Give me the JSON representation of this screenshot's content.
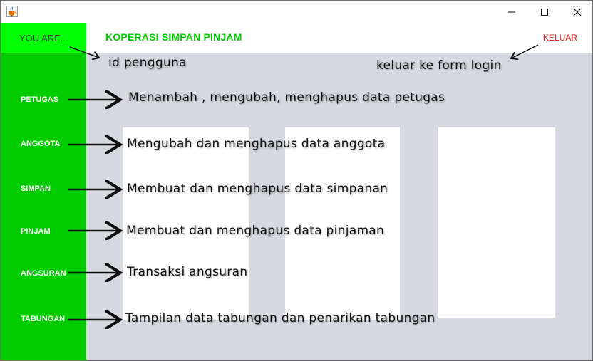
{
  "window": {
    "icon": "java-coffee-cup-icon",
    "controls": {
      "minimize": "minimize-icon",
      "maximize": "maximize-icon",
      "close": "close-icon"
    }
  },
  "header": {
    "user_label": "YOU ARE...",
    "title": "KOPERASI SIMPAN PINJAM",
    "logout_label": "KELUAR"
  },
  "sidebar": {
    "items": [
      {
        "label": "PETUGAS"
      },
      {
        "label": "ANGGOTA"
      },
      {
        "label": "SIMPAN"
      },
      {
        "label": "PINJAM"
      },
      {
        "label": "ANGSURAN"
      },
      {
        "label": "TABUNGAN"
      }
    ]
  },
  "annotations": {
    "user_id": "id pengguna",
    "logout": "keluar ke form login",
    "petugas": "Menambah , mengubah, menghapus data petugas",
    "anggota": "Mengubah dan menghapus data anggota",
    "simpan": "Membuat dan menghapus data simpanan",
    "pinjam": "Membuat dan menghapus data pinjaman",
    "angsuran": "Transaksi angsuran",
    "tabungan": "Tampilan data tabungan dan penarikan tabungan"
  },
  "colors": {
    "accent_green": "#00cc00",
    "bright_green": "#00ff00",
    "logout_red": "#e81010",
    "content_bg": "#d6d9e0"
  }
}
